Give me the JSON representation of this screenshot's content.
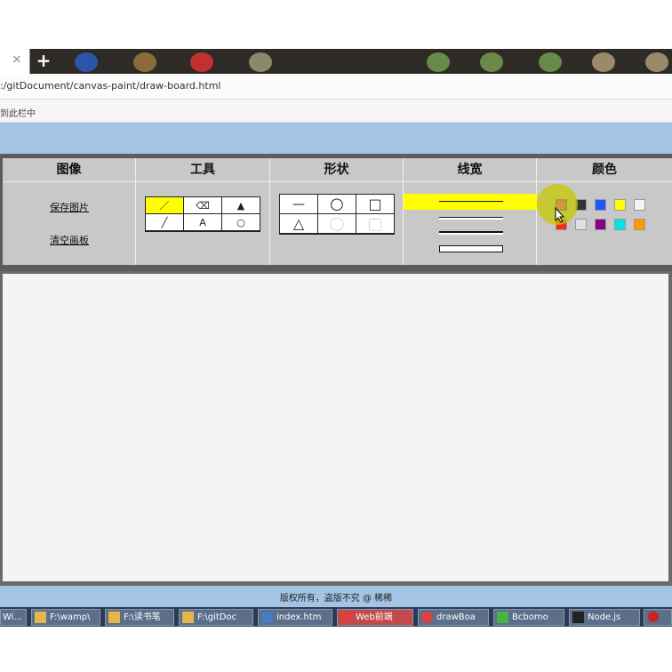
{
  "browser": {
    "tab_close_glyph": "×",
    "new_tab_glyph": "+",
    "url": ":/gitDocument/canvas-paint/draw-board.html",
    "bookmark_text": "到此栏中"
  },
  "toolbar": {
    "sections": [
      {
        "title": "图像"
      },
      {
        "title": "工具"
      },
      {
        "title": "形状"
      },
      {
        "title": "线宽"
      },
      {
        "title": "颜色"
      }
    ],
    "image_buttons": {
      "save": "保存图片",
      "clear": "清空画板"
    },
    "tools": [
      {
        "name": "pencil",
        "glyph": "／",
        "active": true
      },
      {
        "name": "eraser",
        "glyph": "⌫",
        "active": false
      },
      {
        "name": "paint-bucket",
        "glyph": "▲",
        "active": false
      },
      {
        "name": "eyedropper",
        "glyph": "╱",
        "active": false
      },
      {
        "name": "text",
        "glyph": "A",
        "active": false
      },
      {
        "name": "magnifier",
        "glyph": "○",
        "active": false
      }
    ],
    "shapes": [
      {
        "name": "line",
        "glyph": "—"
      },
      {
        "name": "circle",
        "glyph": "○"
      },
      {
        "name": "square",
        "glyph": "□"
      },
      {
        "name": "triangle",
        "glyph": "△"
      },
      {
        "name": "filled-circle",
        "glyph": "●"
      },
      {
        "name": "filled-square",
        "glyph": "■"
      }
    ],
    "line_widths": [
      {
        "value": 1,
        "active": true
      },
      {
        "value": 2,
        "active": false
      },
      {
        "value": 3,
        "active": false
      },
      {
        "value": 5,
        "active": false
      }
    ],
    "colors": [
      "#ff00ff",
      "#333333",
      "#2255ff",
      "#ffff00",
      "#f4f4f4",
      "#ff2222",
      "#e0e0e0",
      "#880088",
      "#00e5e5",
      "#ff9900"
    ],
    "selected_color_index": 0
  },
  "footer": {
    "text": "版权所有，盗版不究 @ 稀稀"
  },
  "taskbar": {
    "items": [
      {
        "label": "Wi...",
        "red": false
      },
      {
        "label": "F:\\wamp\\",
        "red": false
      },
      {
        "label": "F:\\读书笔",
        "red": false
      },
      {
        "label": "F:\\gitDoc",
        "red": false
      },
      {
        "label": "index.htm",
        "red": false
      },
      {
        "label": "Web前端",
        "red": true
      },
      {
        "label": "drawBoa",
        "red": false
      },
      {
        "label": "Bcbomo",
        "red": false
      },
      {
        "label": "Node.js",
        "red": false
      }
    ]
  },
  "colors_theme": {
    "header_blue": "#a3c4e4",
    "toolbar_gray": "#c8c8c8",
    "active_yellow": "#ffff00"
  }
}
